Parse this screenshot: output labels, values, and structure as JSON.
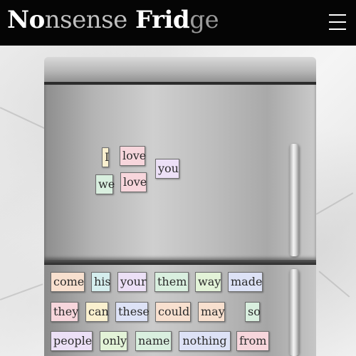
{
  "header": {
    "title_segments": [
      "No",
      "nsense",
      " Frid",
      "ge"
    ],
    "menu_icon": "hamburger-menu-icon"
  },
  "colors": {
    "header_bg": "#050505",
    "title": "#ffffff",
    "magnet_pink": "#f7d6dc",
    "magnet_yellow": "#faf0cf",
    "magnet_green": "#d9efdf",
    "magnet_blue": "#dde2f6",
    "magnet_lavender": "#ece0f6"
  },
  "fridge": {
    "placed_words": [
      "I",
      "love",
      "you",
      "we",
      "love"
    ],
    "word_bank_rows": [
      [
        "come",
        "his",
        "your",
        "them",
        "way",
        "made"
      ],
      [
        "they",
        "can",
        "these",
        "could",
        "may",
        "so"
      ],
      [
        "people",
        "only",
        "name",
        "nothing",
        "from"
      ]
    ]
  }
}
